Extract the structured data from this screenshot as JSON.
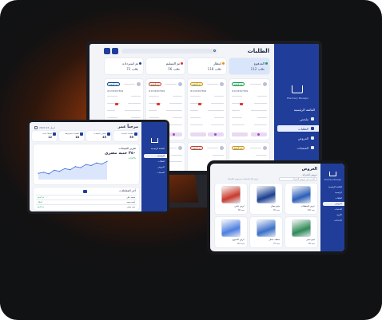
{
  "monitor": {
    "title": "الطلبات",
    "brand": "Pharmacy Manager",
    "sidebar": {
      "section": "القائمة الرئيسية",
      "items": [
        {
          "label": "ملخص"
        },
        {
          "label": "الطلبات"
        },
        {
          "label": "العروض"
        },
        {
          "label": "المنتجات"
        }
      ]
    },
    "status_cards": [
      {
        "label": "المدفوع",
        "value": "112 طلب",
        "color": "#1f9d55"
      },
      {
        "label": "انتظار",
        "value": "118 طلب",
        "color": "#f08c00"
      },
      {
        "label": "تم التسليم",
        "value": "56 طلب",
        "color": "#e03131"
      },
      {
        "label": "تم استرداده",
        "value": "72 طلب",
        "color": "#1f3d99"
      }
    ],
    "order_badge": "تم الدفع",
    "order_id": "#1234567809",
    "order_total": "120 جنيه"
  },
  "laptop": {
    "greeting": "مرحباً عمر",
    "date": "2024 ابريل 24",
    "stats": [
      {
        "label": "الطلبات الجديدة",
        "value": "55"
      },
      {
        "label": "إجمالي المبيعات",
        "value": "45"
      },
      {
        "label": "الطلبات المرفوضة",
        "value": "18"
      },
      {
        "label": "العملاء الجدد",
        "value": "12"
      }
    ],
    "revenue_title": "تقرير المبيعات",
    "revenue_value": "٢٥٠ جنيه مصري",
    "revenue_change": "+٥٫٥%",
    "latest_title": "آخر المعاملات",
    "sidebar_section": "القائمة الرئيسية",
    "sidebar_items": [
      "الرئيسية",
      "الطلبات",
      "العروض",
      "المنتجات"
    ],
    "table_rows": [
      {
        "name": "محمد علي",
        "status": "تم الدفع"
      },
      {
        "name": "أحمد سعيد",
        "status": "انتظار"
      },
      {
        "name": "منى حسن",
        "status": "تم الدفع"
      }
    ],
    "chart_data": {
      "type": "line",
      "x": [
        1,
        2,
        3,
        4,
        5,
        6,
        7,
        8,
        9,
        10,
        11,
        12,
        13,
        14
      ],
      "values": [
        32,
        34,
        31,
        38,
        36,
        41,
        39,
        45,
        43,
        49,
        47,
        52,
        50,
        55
      ],
      "ylim": [
        20,
        60
      ]
    }
  },
  "tablet": {
    "title": "العروض",
    "subtitle": "عروض الشركة",
    "search_placeholder": "البحث في عروض الشركة",
    "filter_label": "عرض كل المنتجات وعروض الشركة",
    "brand": "Pharmacy Manager",
    "sidebar_section": "القائمة الرئيسية",
    "sidebar_items": [
      "الرئيسية",
      "الطلبات",
      "العروض",
      "المنتجات",
      "الأدوية",
      "الإعدادات"
    ],
    "products": [
      {
        "name": "عرض المنظفات",
        "price": "120 جنيه",
        "color": "#2b5fb8"
      },
      {
        "name": "منتج ممتاز",
        "price": "95 جنيه",
        "color": "#1a3f8f"
      },
      {
        "name": "عرض خاص",
        "price": "80 جنيه",
        "color": "#c93a2c"
      },
      {
        "name": "منتج مميز",
        "price": "60 جنيه",
        "color": "#2f8a57"
      },
      {
        "name": "منظف ممتاز",
        "price": "75 جنيه",
        "color": "#3b6fc9"
      },
      {
        "name": "عرض الأسبوع",
        "price": "110 جنيه",
        "color": "#4d7ee0"
      }
    ]
  },
  "colors": {
    "accent": "#1f3d99",
    "background_glow": "#b44a14"
  }
}
